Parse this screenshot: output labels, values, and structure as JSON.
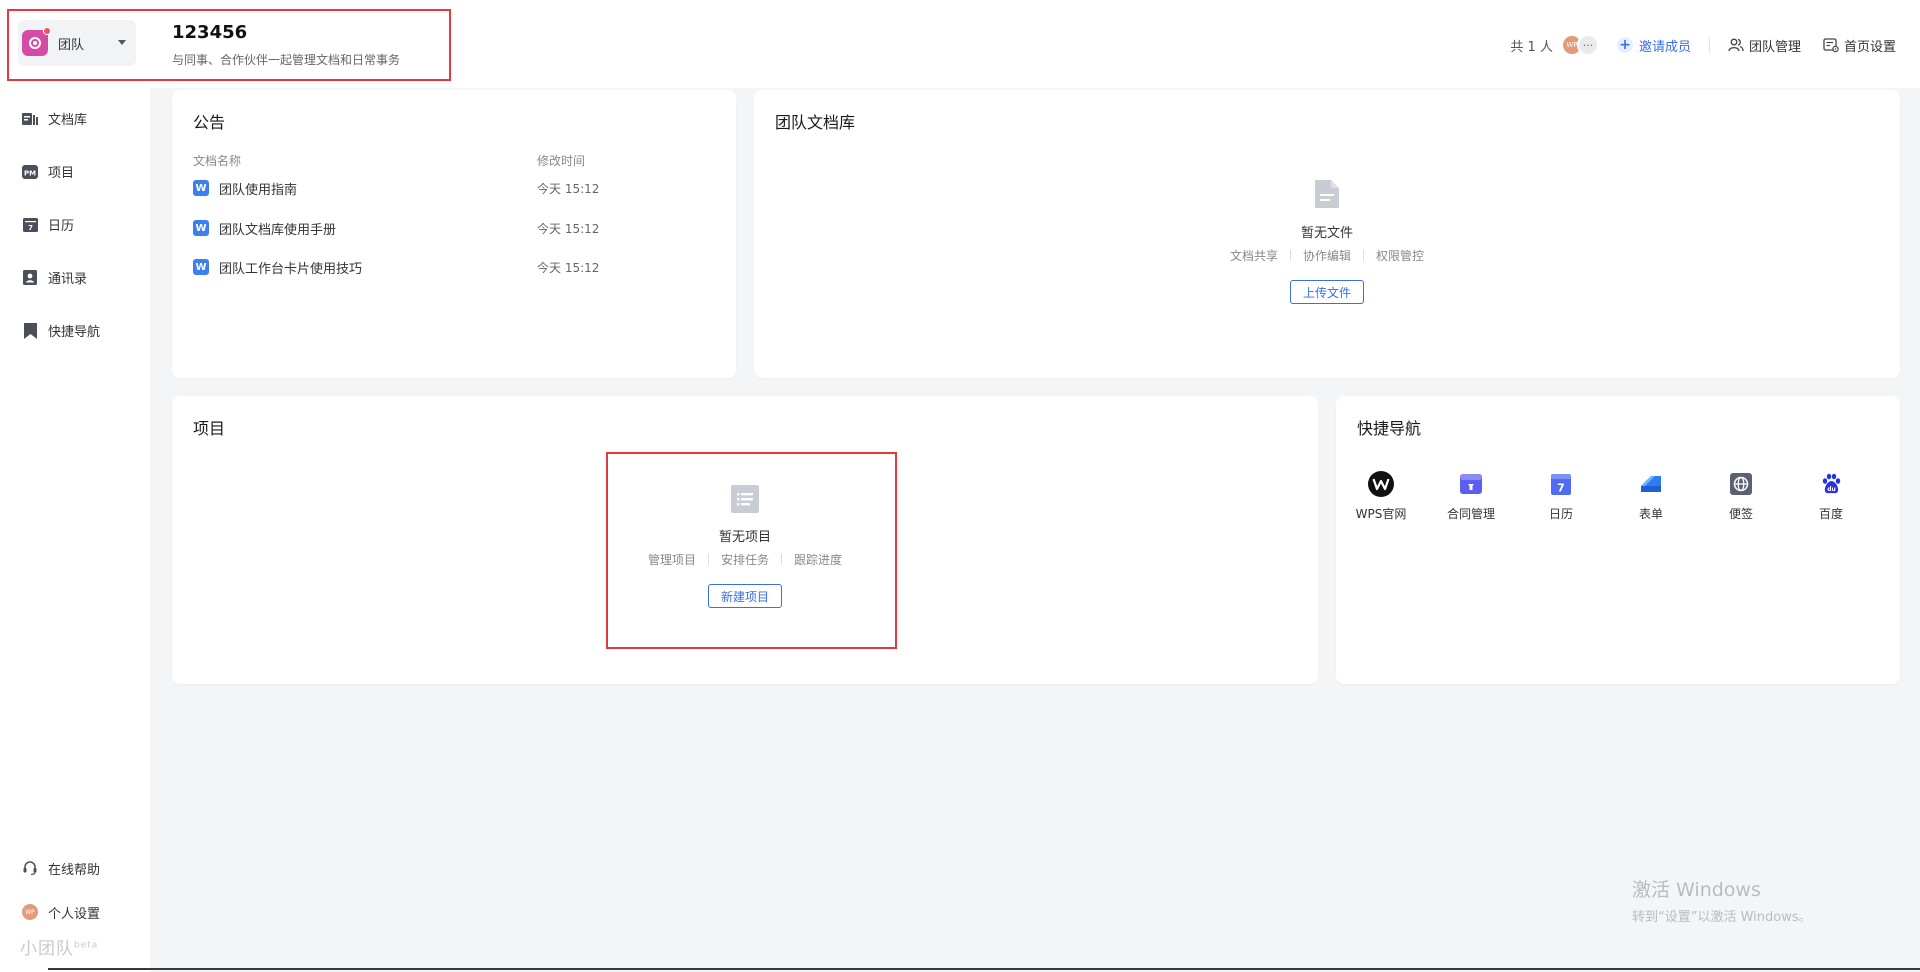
{
  "team_switcher": {
    "name": "团队"
  },
  "header": {
    "title": "123456",
    "description": "与同事、合作伙伴一起管理文档和日常事务",
    "member_count": "共 1 人",
    "avatar_text": "WP",
    "more_text": "···",
    "invite_label": "邀请成员",
    "team_manage_label": "团队管理",
    "home_settings_label": "首页设置"
  },
  "sidebar": {
    "items": [
      {
        "label": "文档库",
        "icon": "doc-library-icon"
      },
      {
        "label": "项目",
        "icon": "project-pm-icon"
      },
      {
        "label": "日历",
        "icon": "calendar-icon"
      },
      {
        "label": "通讯录",
        "icon": "contacts-icon"
      },
      {
        "label": "快捷导航",
        "icon": "bookmark-icon"
      }
    ],
    "help_label": "在线帮助",
    "settings_label": "个人设置",
    "settings_avatar": "WP",
    "brand": "小团队",
    "brand_sup": "beta"
  },
  "announcement": {
    "title": "公告",
    "col_name": "文档名称",
    "col_time": "修改时间",
    "rows": [
      {
        "name": "团队使用指南",
        "time": "今天 15:12"
      },
      {
        "name": "团队文档库使用手册",
        "time": "今天 15:12"
      },
      {
        "name": "团队工作台卡片使用技巧",
        "time": "今天 15:12"
      }
    ]
  },
  "team_docs": {
    "title": "团队文档库",
    "empty_title": "暂无文件",
    "tags": [
      "文档共享",
      "协作编辑",
      "权限管控"
    ],
    "button": "上传文件"
  },
  "projects": {
    "title": "项目",
    "empty_title": "暂无项目",
    "tags": [
      "管理项目",
      "安排任务",
      "跟踪进度"
    ],
    "button": "新建项目"
  },
  "quick_nav": {
    "title": "快捷导航",
    "items": [
      {
        "label": "WPS官网",
        "icon": "wps-logo-icon"
      },
      {
        "label": "合同管理",
        "icon": "contract-icon"
      },
      {
        "label": "日历",
        "icon": "calendar-icon"
      },
      {
        "label": "表单",
        "icon": "form-icon"
      },
      {
        "label": "便签",
        "icon": "note-icon"
      },
      {
        "label": "百度",
        "icon": "baidu-icon"
      }
    ]
  },
  "watermark": {
    "line1": "激活 Windows",
    "line2": "转到“设置”以激活 Windows。"
  },
  "colors": {
    "accent": "#3a6ee8",
    "highlight": "#e0393e",
    "team_logo": "#d64ba5"
  }
}
